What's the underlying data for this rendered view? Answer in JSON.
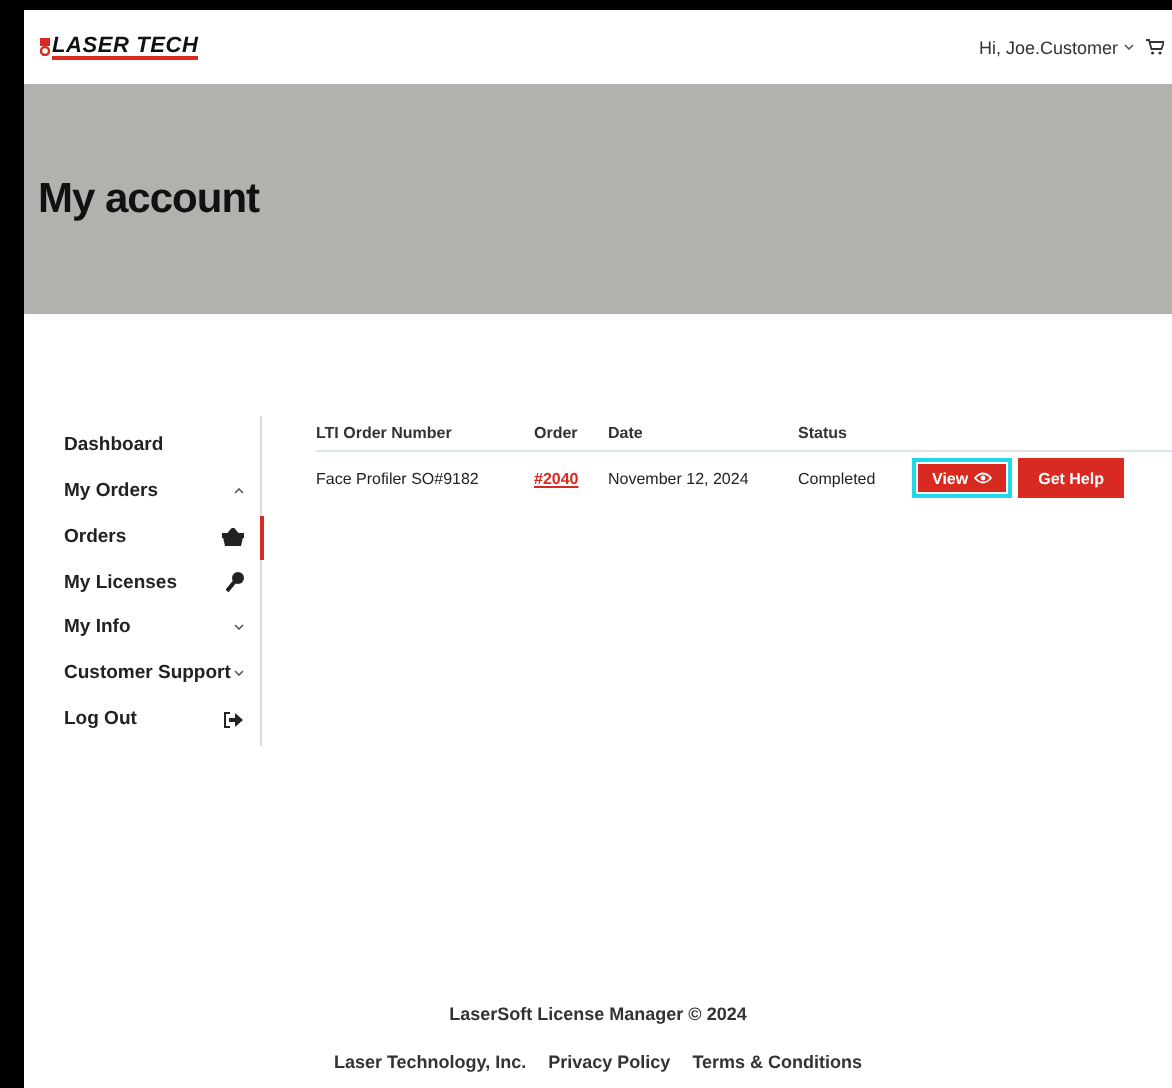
{
  "header": {
    "logo": "LASER TECH",
    "user_menu": "Hi, Joe.Customer"
  },
  "banner": {
    "title": "My account"
  },
  "sidebar": {
    "items": [
      {
        "label": "Dashboard",
        "kind": "plain",
        "selected": false
      },
      {
        "label": "My Orders",
        "kind": "group",
        "expanded": true,
        "selected": false
      },
      {
        "label": "Orders",
        "kind": "basket",
        "selected": true
      },
      {
        "label": "My Licenses",
        "kind": "key",
        "selected": false
      },
      {
        "label": "My Info",
        "kind": "group",
        "expanded": false,
        "selected": false
      },
      {
        "label": "Customer Support",
        "kind": "group",
        "expanded": false,
        "selected": false
      },
      {
        "label": "Log Out",
        "kind": "logout",
        "selected": false
      }
    ]
  },
  "table": {
    "columns": [
      "LTI Order Number",
      "Order",
      "Date",
      "Status"
    ],
    "rows": [
      {
        "number": "Face Profiler SO#9182",
        "order": "#2040",
        "date": "November 12, 2024",
        "status": "Completed",
        "actions": [
          {
            "label": "View",
            "kind": "view",
            "focused": true
          },
          {
            "label": "Get Help",
            "kind": "help",
            "focused": false
          }
        ]
      }
    ]
  },
  "footer": {
    "copyright": "LaserSoft License Manager © 2024",
    "links": [
      "Laser Technology, Inc.",
      "Privacy Policy",
      "Terms & Conditions"
    ]
  }
}
